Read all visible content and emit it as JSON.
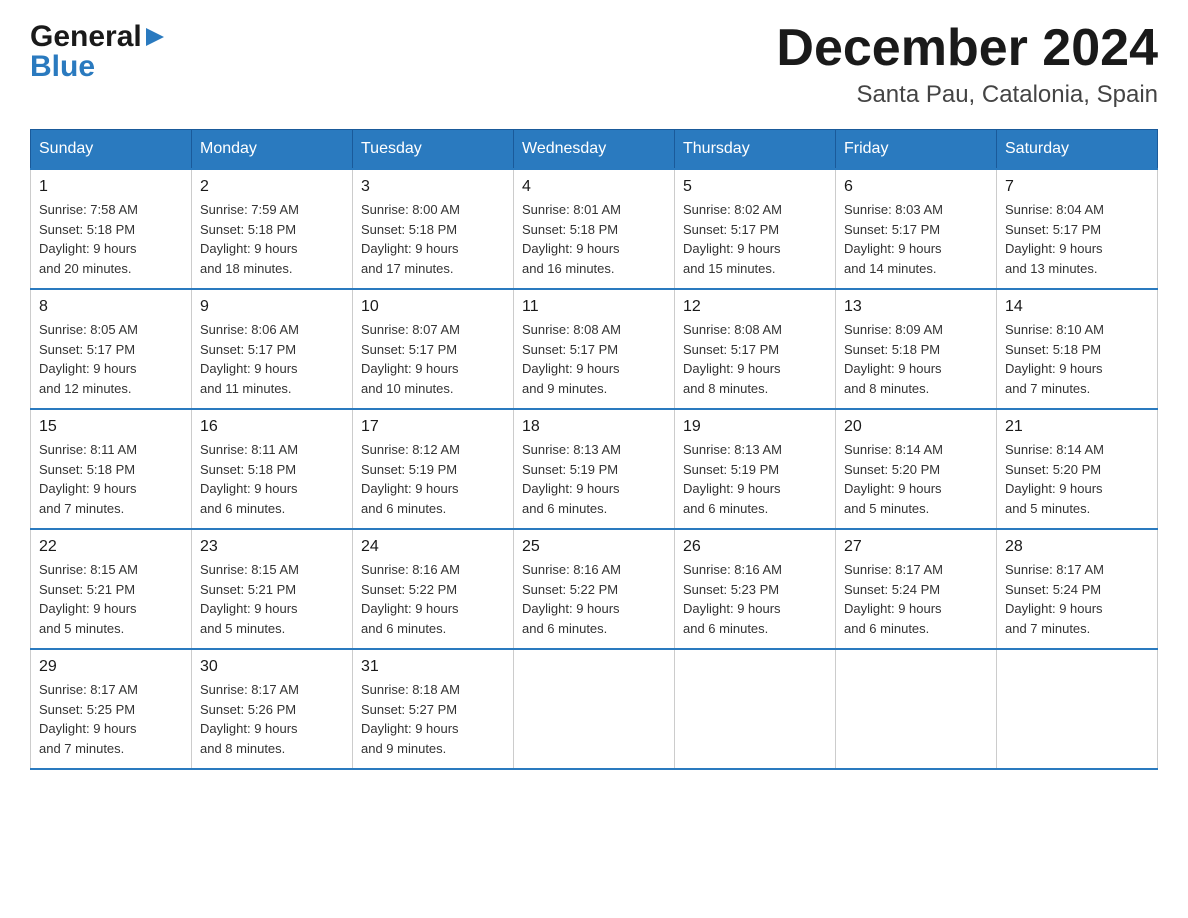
{
  "header": {
    "logo_general": "General",
    "logo_blue": "Blue",
    "month_title": "December 2024",
    "location": "Santa Pau, Catalonia, Spain"
  },
  "days_of_week": [
    "Sunday",
    "Monday",
    "Tuesday",
    "Wednesday",
    "Thursday",
    "Friday",
    "Saturday"
  ],
  "weeks": [
    [
      {
        "day": "1",
        "sunrise": "7:58 AM",
        "sunset": "5:18 PM",
        "daylight": "9 hours and 20 minutes."
      },
      {
        "day": "2",
        "sunrise": "7:59 AM",
        "sunset": "5:18 PM",
        "daylight": "9 hours and 18 minutes."
      },
      {
        "day": "3",
        "sunrise": "8:00 AM",
        "sunset": "5:18 PM",
        "daylight": "9 hours and 17 minutes."
      },
      {
        "day": "4",
        "sunrise": "8:01 AM",
        "sunset": "5:18 PM",
        "daylight": "9 hours and 16 minutes."
      },
      {
        "day": "5",
        "sunrise": "8:02 AM",
        "sunset": "5:17 PM",
        "daylight": "9 hours and 15 minutes."
      },
      {
        "day": "6",
        "sunrise": "8:03 AM",
        "sunset": "5:17 PM",
        "daylight": "9 hours and 14 minutes."
      },
      {
        "day": "7",
        "sunrise": "8:04 AM",
        "sunset": "5:17 PM",
        "daylight": "9 hours and 13 minutes."
      }
    ],
    [
      {
        "day": "8",
        "sunrise": "8:05 AM",
        "sunset": "5:17 PM",
        "daylight": "9 hours and 12 minutes."
      },
      {
        "day": "9",
        "sunrise": "8:06 AM",
        "sunset": "5:17 PM",
        "daylight": "9 hours and 11 minutes."
      },
      {
        "day": "10",
        "sunrise": "8:07 AM",
        "sunset": "5:17 PM",
        "daylight": "9 hours and 10 minutes."
      },
      {
        "day": "11",
        "sunrise": "8:08 AM",
        "sunset": "5:17 PM",
        "daylight": "9 hours and 9 minutes."
      },
      {
        "day": "12",
        "sunrise": "8:08 AM",
        "sunset": "5:17 PM",
        "daylight": "9 hours and 8 minutes."
      },
      {
        "day": "13",
        "sunrise": "8:09 AM",
        "sunset": "5:18 PM",
        "daylight": "9 hours and 8 minutes."
      },
      {
        "day": "14",
        "sunrise": "8:10 AM",
        "sunset": "5:18 PM",
        "daylight": "9 hours and 7 minutes."
      }
    ],
    [
      {
        "day": "15",
        "sunrise": "8:11 AM",
        "sunset": "5:18 PM",
        "daylight": "9 hours and 7 minutes."
      },
      {
        "day": "16",
        "sunrise": "8:11 AM",
        "sunset": "5:18 PM",
        "daylight": "9 hours and 6 minutes."
      },
      {
        "day": "17",
        "sunrise": "8:12 AM",
        "sunset": "5:19 PM",
        "daylight": "9 hours and 6 minutes."
      },
      {
        "day": "18",
        "sunrise": "8:13 AM",
        "sunset": "5:19 PM",
        "daylight": "9 hours and 6 minutes."
      },
      {
        "day": "19",
        "sunrise": "8:13 AM",
        "sunset": "5:19 PM",
        "daylight": "9 hours and 6 minutes."
      },
      {
        "day": "20",
        "sunrise": "8:14 AM",
        "sunset": "5:20 PM",
        "daylight": "9 hours and 5 minutes."
      },
      {
        "day": "21",
        "sunrise": "8:14 AM",
        "sunset": "5:20 PM",
        "daylight": "9 hours and 5 minutes."
      }
    ],
    [
      {
        "day": "22",
        "sunrise": "8:15 AM",
        "sunset": "5:21 PM",
        "daylight": "9 hours and 5 minutes."
      },
      {
        "day": "23",
        "sunrise": "8:15 AM",
        "sunset": "5:21 PM",
        "daylight": "9 hours and 5 minutes."
      },
      {
        "day": "24",
        "sunrise": "8:16 AM",
        "sunset": "5:22 PM",
        "daylight": "9 hours and 6 minutes."
      },
      {
        "day": "25",
        "sunrise": "8:16 AM",
        "sunset": "5:22 PM",
        "daylight": "9 hours and 6 minutes."
      },
      {
        "day": "26",
        "sunrise": "8:16 AM",
        "sunset": "5:23 PM",
        "daylight": "9 hours and 6 minutes."
      },
      {
        "day": "27",
        "sunrise": "8:17 AM",
        "sunset": "5:24 PM",
        "daylight": "9 hours and 6 minutes."
      },
      {
        "day": "28",
        "sunrise": "8:17 AM",
        "sunset": "5:24 PM",
        "daylight": "9 hours and 7 minutes."
      }
    ],
    [
      {
        "day": "29",
        "sunrise": "8:17 AM",
        "sunset": "5:25 PM",
        "daylight": "9 hours and 7 minutes."
      },
      {
        "day": "30",
        "sunrise": "8:17 AM",
        "sunset": "5:26 PM",
        "daylight": "9 hours and 8 minutes."
      },
      {
        "day": "31",
        "sunrise": "8:18 AM",
        "sunset": "5:27 PM",
        "daylight": "9 hours and 9 minutes."
      },
      null,
      null,
      null,
      null
    ]
  ],
  "labels": {
    "sunrise": "Sunrise:",
    "sunset": "Sunset:",
    "daylight": "Daylight:"
  }
}
